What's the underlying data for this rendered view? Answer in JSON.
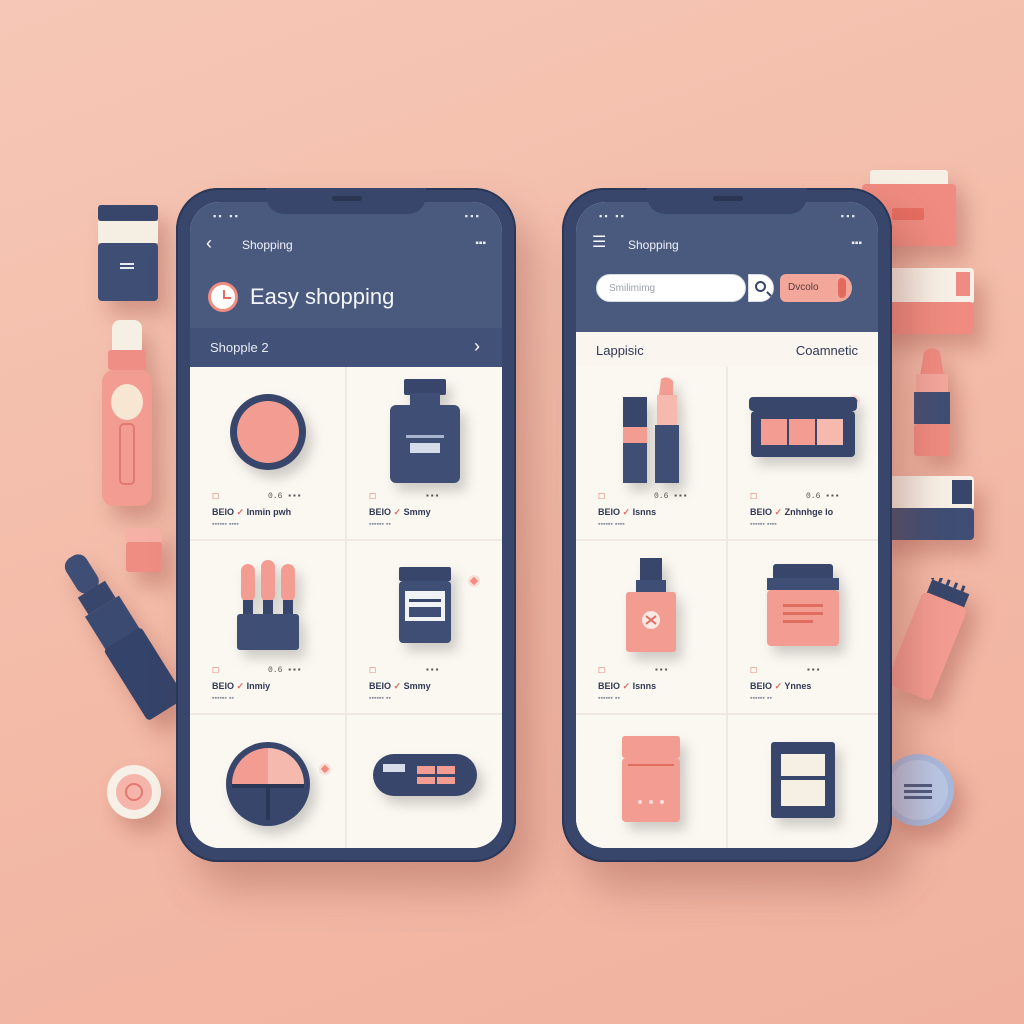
{
  "colors": {
    "navy": "#37466a",
    "coral": "#f08c80",
    "background": "#f3baa7",
    "cream": "#faf5ee"
  },
  "left_phone": {
    "status_left": "▪▪ ▪▪",
    "status_right": "▪▪▪",
    "back_icon": "chevron-left-icon",
    "title": "Shopping",
    "cart_label": "▪▪▪",
    "hero_icon": "clock-icon",
    "hero_title": "Easy shopping",
    "section_label": "Shopple 2",
    "section_chevron": "›",
    "products": [
      {
        "icon": "compact-powder-icon",
        "price": "☐",
        "code": "0.6 ▪▪▪",
        "name": "BEIO",
        "name_mark": "✓",
        "name_rest": "Inmin pwh",
        "sub": "▪▪▪▪▪▪  ▪▪▪▪"
      },
      {
        "icon": "jar-bottle-icon",
        "price": "☐",
        "code": "▪▪▪",
        "name": "BEIO",
        "name_mark": "✓",
        "name_rest": "Smmy",
        "sub": "▪▪▪▪▪▪  ▪▪"
      },
      {
        "icon": "brush-set-icon",
        "price": "☐",
        "code": "0.6 ▪▪▪",
        "name": "BEIO",
        "name_mark": "✓",
        "name_rest": "Inmiy",
        "sub": "▪▪▪▪▪▪  ▪▪"
      },
      {
        "icon": "tube-jar-icon",
        "price": "☐",
        "code": "▪▪▪",
        "name": "BEIO",
        "name_mark": "✓",
        "name_rest": "Smmy",
        "sub": "▪▪▪▪▪▪  ▪▪"
      },
      {
        "icon": "palette-compact-icon",
        "price": "",
        "code": "",
        "name": "",
        "name_mark": "",
        "name_rest": "",
        "sub": ""
      },
      {
        "icon": "blush-palette-icon",
        "price": "",
        "code": "",
        "name": "",
        "name_mark": "",
        "name_rest": "",
        "sub": ""
      }
    ]
  },
  "right_phone": {
    "status_left": "▪▪ ▪▪",
    "status_right": "▪▪▪",
    "menu_icon": "hamburger-menu-icon",
    "title": "Shopping",
    "cart_label": "▪▪▪",
    "search_placeholder": "Smilimimg",
    "search_icon": "magnifier-icon",
    "filter_chip": "Dvcolo",
    "category_left": "Lappisic",
    "category_right": "Coamnetic",
    "products": [
      {
        "icon": "lipstick-pair-icon",
        "price": "☐",
        "code": "0.6 ▪▪▪",
        "name": "BEIO",
        "name_mark": "✓",
        "name_rest": "Isnns",
        "sub": "▪▪▪▪▪▪  ▪▪▪▪"
      },
      {
        "icon": "eyeshadow-palette-icon",
        "price": "☐",
        "code": "0.6 ▪▪▪",
        "name": "BEIO",
        "name_mark": "✓",
        "name_rest": "Znhnhge lo",
        "sub": "▪▪▪▪▪▪  ▪▪▪▪"
      },
      {
        "icon": "serum-bottle-icon",
        "price": "☐",
        "code": "▪▪▪",
        "name": "BEIO",
        "name_mark": "✓",
        "name_rest": "Isnns",
        "sub": "▪▪▪▪▪▪  ▪▪"
      },
      {
        "icon": "cream-jar-icon",
        "price": "☐",
        "code": "▪▪▪",
        "name": "BEIO",
        "name_mark": "✓",
        "name_rest": "Ynnes",
        "sub": "▪▪▪▪▪▪  ▪▪"
      },
      {
        "icon": "foundation-bottle-icon",
        "price": "",
        "code": "",
        "name": "",
        "name_mark": "",
        "name_rest": "",
        "sub": ""
      },
      {
        "icon": "square-compact-icon",
        "price": "",
        "code": "",
        "name": "",
        "name_mark": "",
        "name_rest": "",
        "sub": ""
      }
    ]
  },
  "decor_icons": [
    "concealer-tube-icon",
    "roll-on-bottle-icon",
    "mini-jar-icon",
    "lipstick-icon",
    "round-jar-icon",
    "cream-box-icon",
    "lip-balm-icon",
    "brush-tube-icon",
    "compact-case-icon"
  ]
}
